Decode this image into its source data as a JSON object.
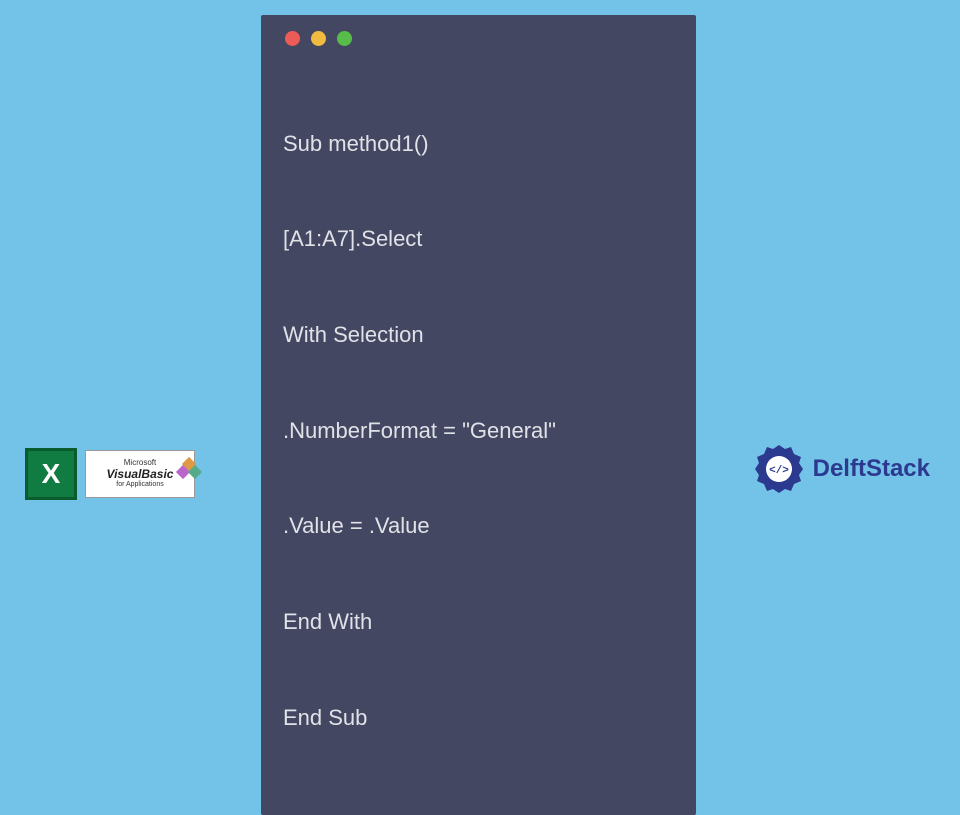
{
  "code": {
    "lines": [
      "Sub method1()",
      "[A1:A7].Select",
      "With Selection",
      ".NumberFormat = \"General\"",
      ".Value = .Value",
      "End With",
      "End Sub"
    ]
  },
  "logos": {
    "excel_letter": "X",
    "vb_ms": "Microsoft",
    "vb_title": "VisualBasic",
    "vb_sub": "for Applications",
    "delft": "DelftStack"
  },
  "colors": {
    "bg": "#73c2e8",
    "window": "#434761",
    "text": "#e1e2e8",
    "delft_blue": "#2b3a8f"
  }
}
